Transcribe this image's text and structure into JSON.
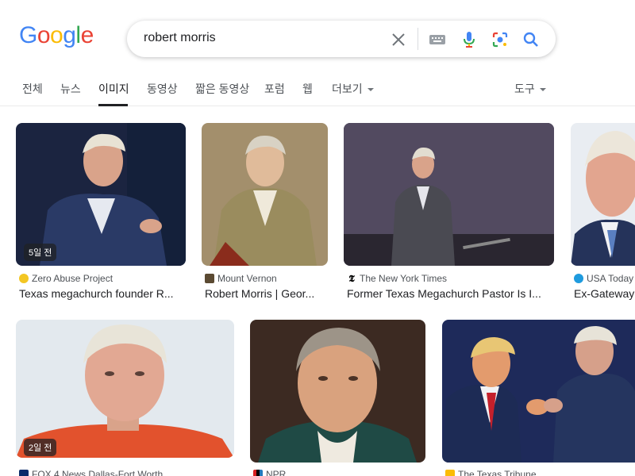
{
  "logo": [
    "G",
    "o",
    "o",
    "g",
    "l",
    "e"
  ],
  "search": {
    "query": "robert morris"
  },
  "tabs": {
    "all": "전체",
    "news": "뉴스",
    "images": "이미지",
    "videos": "동영상",
    "short_videos": "짧은 동영상",
    "forums": "포럼",
    "web": "웹",
    "more": "더보기",
    "tools": "도구"
  },
  "results": [
    {
      "badge": "5일 전",
      "source": "Zero Abuse Project",
      "title": "Texas megachurch founder R..."
    },
    {
      "source": "Mount Vernon",
      "title": "Robert Morris | Geor..."
    },
    {
      "source": "The New York Times",
      "title": "Former Texas Megachurch Pastor Is I..."
    },
    {
      "source": "USA Today",
      "title": "Ex-Gateway"
    },
    {
      "badge": "2일 전",
      "source": "FOX 4 News Dallas-Fort Worth"
    },
    {
      "source": "NPR"
    },
    {
      "source": "The Texas Tribune"
    }
  ],
  "colors": {
    "blue": "#4285f4",
    "red": "#ea4335",
    "yellow": "#fbbc05",
    "green": "#34a853"
  }
}
